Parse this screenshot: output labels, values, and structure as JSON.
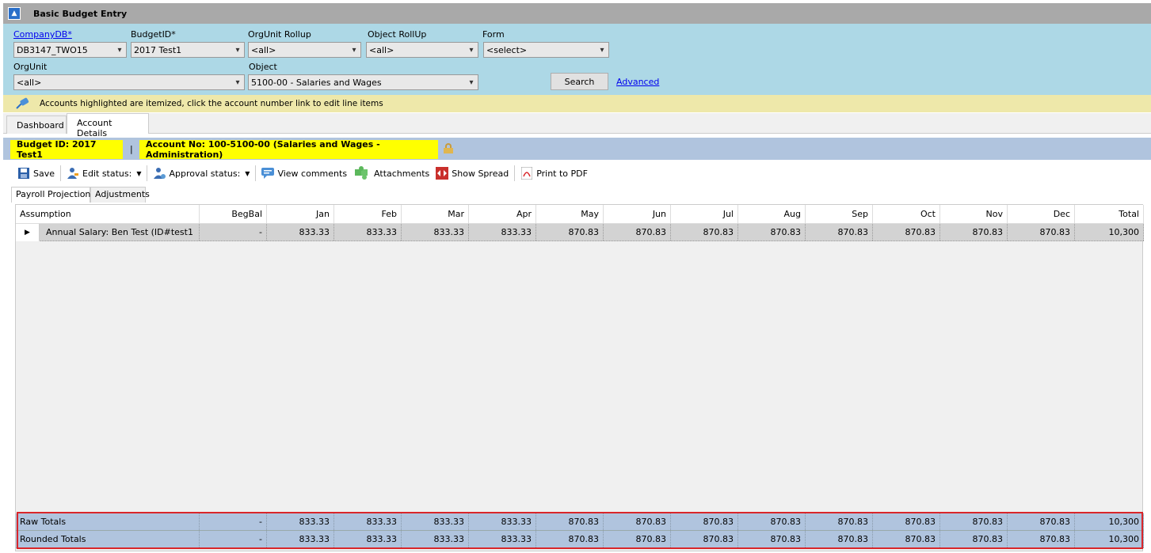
{
  "window": {
    "title": "Basic Budget Entry"
  },
  "filters": {
    "company_db": {
      "label": "CompanyDB*",
      "value": "DB3147_TWO15"
    },
    "budget_id": {
      "label": "BudgetID*",
      "value": "2017 Test1"
    },
    "orgunit_rollup": {
      "label": "OrgUnit Rollup",
      "value": "<all>"
    },
    "object_rollup": {
      "label": "Object RollUp",
      "value": "<all>"
    },
    "form": {
      "label": "Form",
      "value": "<select>"
    },
    "orgunit": {
      "label": "OrgUnit",
      "value": "<all>"
    },
    "object": {
      "label": "Object",
      "value": "5100-00 - Salaries and Wages"
    },
    "search_label": "Search",
    "advanced_label": "Advanced"
  },
  "notice": {
    "text": "Accounts highlighted are itemized, click the account number link to edit line items"
  },
  "tabs": {
    "dashboard": "Dashboard",
    "account_details": "Account Details"
  },
  "infobar": {
    "budget": "Budget ID: 2017 Test1",
    "separator": "|",
    "account": "Account No: 100-5100-00 (Salaries and Wages - Administration)"
  },
  "toolbar": {
    "save": "Save",
    "edit_status": "Edit status:",
    "approval_status": "Approval status:",
    "view_comments": "View comments",
    "attachments": "Attachments",
    "show_spread": "Show Spread",
    "print_pdf": "Print to PDF"
  },
  "subtabs": {
    "payroll": "Payroll Projections",
    "adjustments": "Adjustments"
  },
  "grid": {
    "columns": [
      "Assumption",
      "BegBal",
      "Jan",
      "Feb",
      "Mar",
      "Apr",
      "May",
      "Jun",
      "Jul",
      "Aug",
      "Sep",
      "Oct",
      "Nov",
      "Dec",
      "Total"
    ],
    "rows": [
      {
        "assumption": "Annual Salary: Ben  Test (ID#test1",
        "begbal": "-",
        "jan": "833.33",
        "feb": "833.33",
        "mar": "833.33",
        "apr": "833.33",
        "may": "870.83",
        "jun": "870.83",
        "jul": "870.83",
        "aug": "870.83",
        "sep": "870.83",
        "oct": "870.83",
        "nov": "870.83",
        "dec": "870.83",
        "total": "10,300"
      }
    ],
    "totals": [
      {
        "label": "Raw Totals",
        "begbal": "-",
        "jan": "833.33",
        "feb": "833.33",
        "mar": "833.33",
        "apr": "833.33",
        "may": "870.83",
        "jun": "870.83",
        "jul": "870.83",
        "aug": "870.83",
        "sep": "870.83",
        "oct": "870.83",
        "nov": "870.83",
        "dec": "870.83",
        "total": "10,300"
      },
      {
        "label": "Rounded Totals",
        "begbal": "-",
        "jan": "833.33",
        "feb": "833.33",
        "mar": "833.33",
        "apr": "833.33",
        "may": "870.83",
        "jun": "870.83",
        "jul": "870.83",
        "aug": "870.83",
        "sep": "870.83",
        "oct": "870.83",
        "nov": "870.83",
        "dec": "870.83",
        "total": "10,300"
      }
    ]
  },
  "colors": {
    "filter_bg": "#add8e6",
    "notice_bg": "#eee8aa",
    "badge_bg": "#ffff00",
    "totals_bg": "#b0c4de",
    "highlight": "#d9262a"
  }
}
